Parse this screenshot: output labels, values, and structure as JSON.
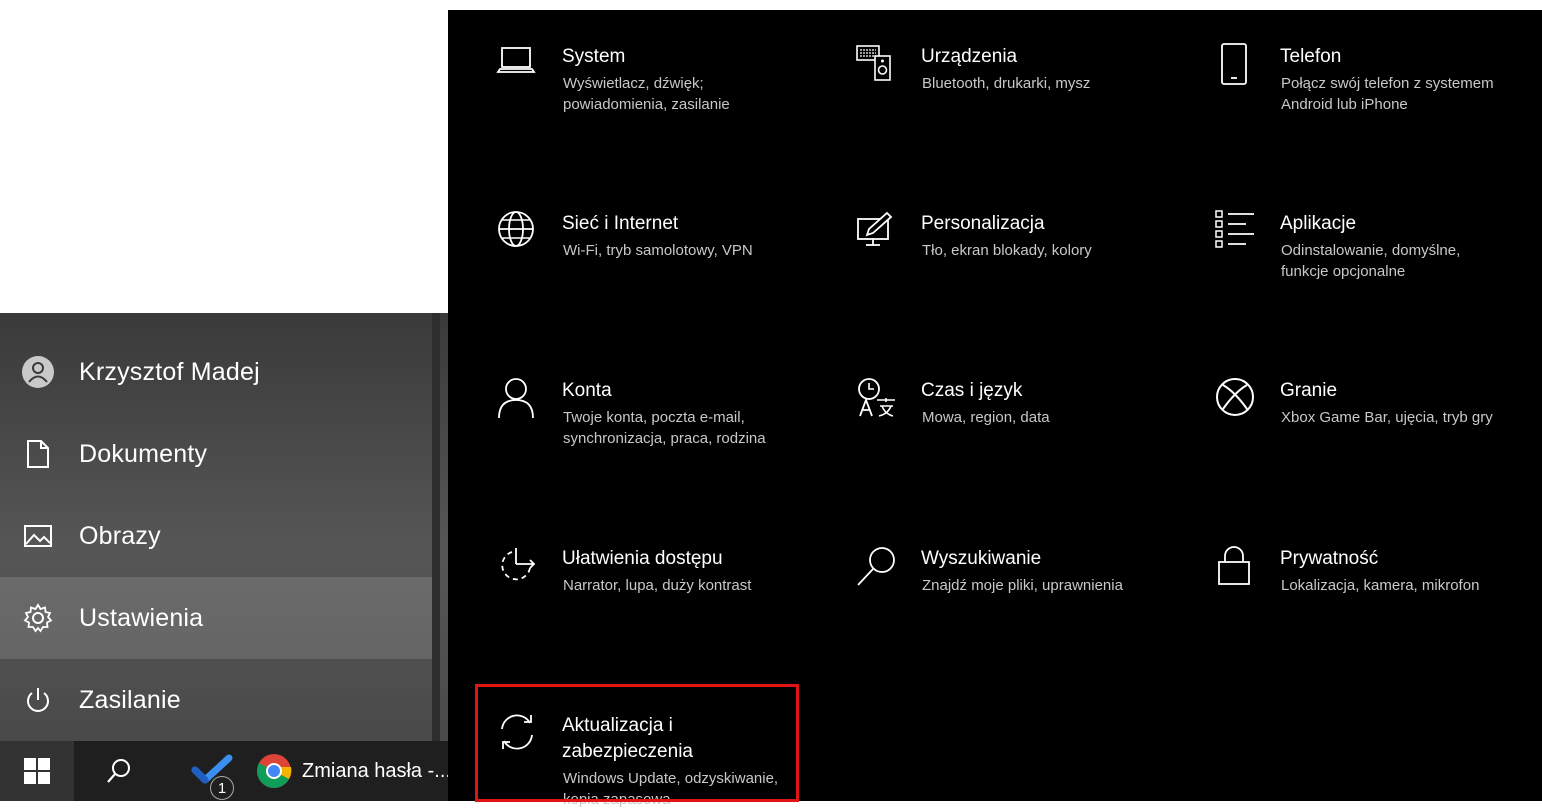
{
  "start_menu": {
    "items": [
      {
        "label": "Krzysztof Madej",
        "icon": "user-avatar-icon"
      },
      {
        "label": "Dokumenty",
        "icon": "document-icon"
      },
      {
        "label": "Obrazy",
        "icon": "picture-icon"
      },
      {
        "label": "Ustawienia",
        "icon": "gear-icon",
        "active": true
      },
      {
        "label": "Zasilanie",
        "icon": "power-icon"
      }
    ]
  },
  "taskbar": {
    "todo_badge": "1",
    "chrome_label": "Zmiana hasła -..."
  },
  "settings": {
    "tiles": [
      {
        "title": "System",
        "desc": "Wyświetlacz, dźwięk;\npowiadomienia, zasilanie",
        "icon": "laptop-icon"
      },
      {
        "title": "Urządzenia",
        "desc": "Bluetooth, drukarki, mysz",
        "icon": "devices-icon"
      },
      {
        "title": "Telefon",
        "desc": "Połącz swój telefon z systemem\nAndroid lub iPhone",
        "icon": "phone-icon"
      },
      {
        "title": "Sieć i Internet",
        "desc": "Wi-Fi, tryb samolotowy, VPN",
        "icon": "globe-icon"
      },
      {
        "title": "Personalizacja",
        "desc": "Tło, ekran blokady, kolory",
        "icon": "personalization-icon"
      },
      {
        "title": "Aplikacje",
        "desc": "Odinstalowanie, domyślne,\nfunkcje opcjonalne",
        "icon": "apps-list-icon"
      },
      {
        "title": "Konta",
        "desc": "Twoje konta, poczta e-mail,\nsynchronizacja, praca, rodzina",
        "icon": "account-icon"
      },
      {
        "title": "Czas i język",
        "desc": "Mowa, region, data",
        "icon": "time-language-icon"
      },
      {
        "title": "Granie",
        "desc": "Xbox Game Bar, ujęcia, tryb gry",
        "icon": "xbox-icon"
      },
      {
        "title": "Ułatwienia dostępu",
        "desc": "Narrator, lupa, duży kontrast",
        "icon": "accessibility-icon"
      },
      {
        "title": "Wyszukiwanie",
        "desc": "Znajdź moje pliki, uprawnienia",
        "icon": "search-icon"
      },
      {
        "title": "Prywatność",
        "desc": "Lokalizacja, kamera, mikrofon",
        "icon": "lock-icon"
      },
      {
        "title": "Aktualizacja i\nzabezpieczenia",
        "desc": "Windows Update, odzyskiwanie,\nkopia zapasowa",
        "icon": "sync-icon"
      }
    ]
  },
  "colors": {
    "highlight_border": "#e11414",
    "settings_bg": "#000000",
    "start_menu_bg": "#4a4a4a"
  }
}
